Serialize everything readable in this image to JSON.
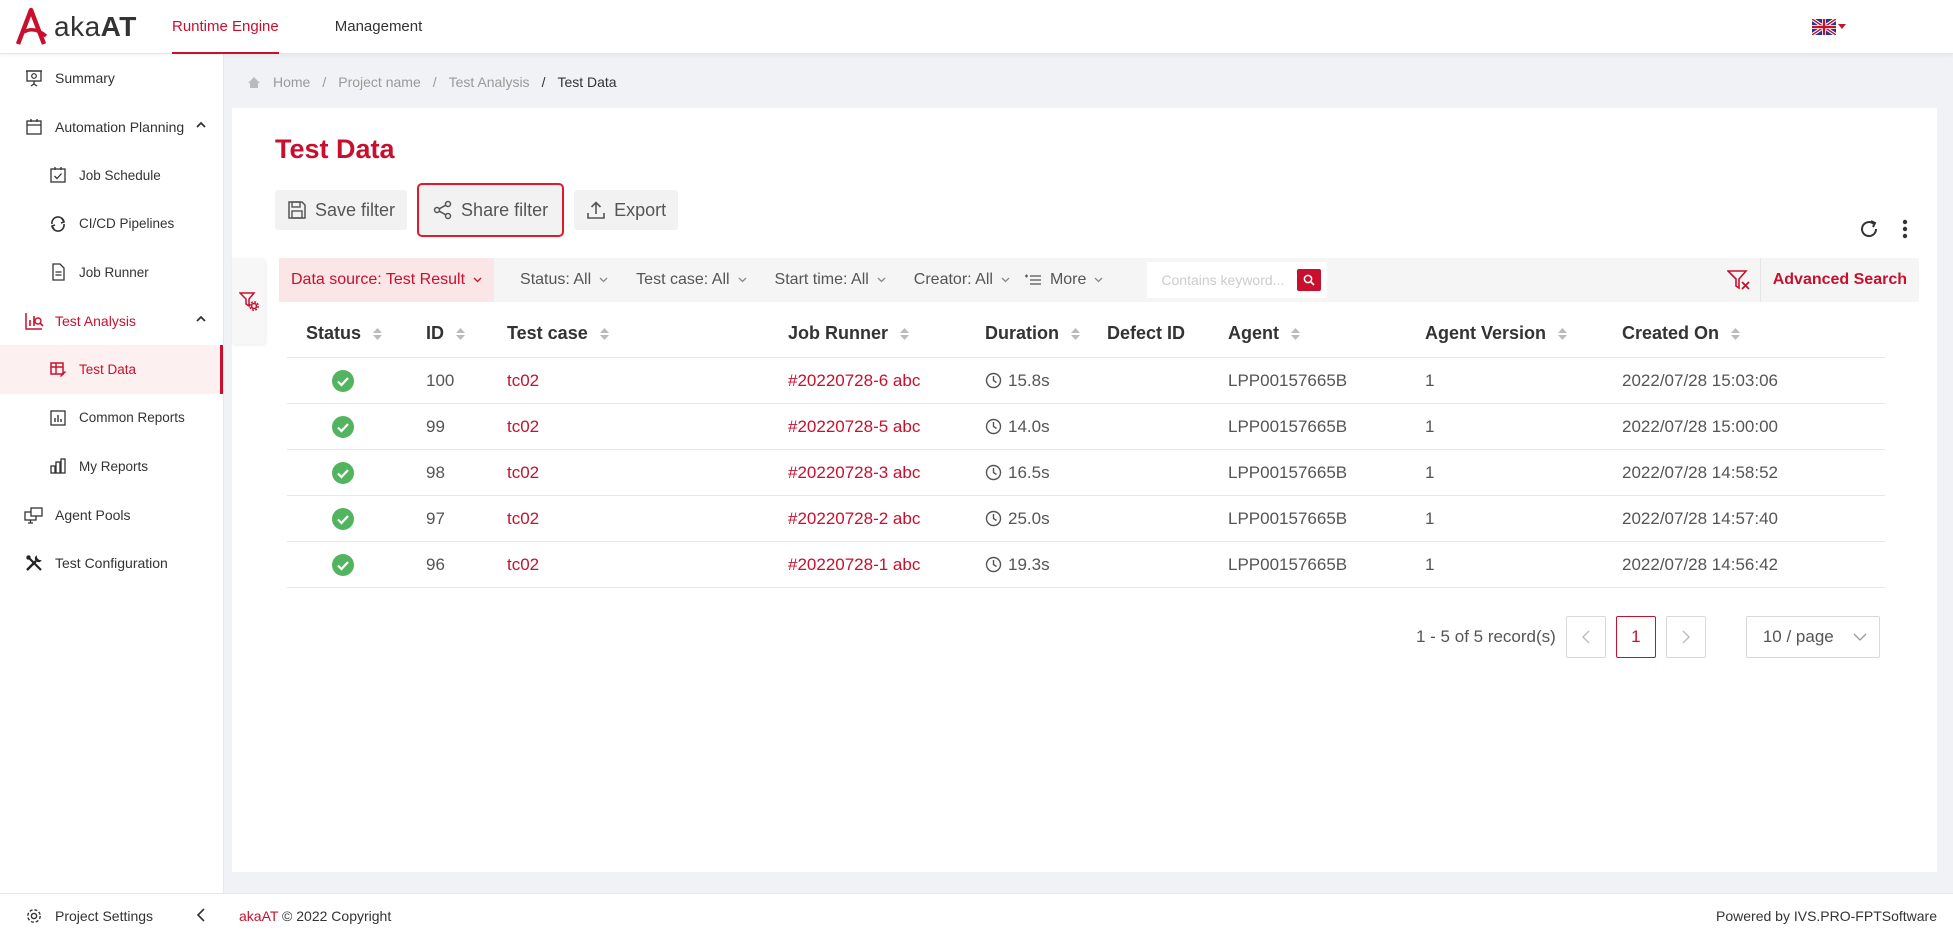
{
  "app": {
    "logo_prefix": "aka",
    "logo_suffix": "AT",
    "nav": [
      "Runtime Engine",
      "Management"
    ]
  },
  "sidebar": {
    "items": [
      {
        "label": "Summary"
      },
      {
        "label": "Automation Planning"
      },
      {
        "label": "Job Schedule"
      },
      {
        "label": "CI/CD Pipelines"
      },
      {
        "label": "Job Runner"
      },
      {
        "label": "Test Analysis"
      },
      {
        "label": "Test Data"
      },
      {
        "label": "Common Reports"
      },
      {
        "label": "My Reports"
      },
      {
        "label": "Agent Pools"
      },
      {
        "label": "Test Configuration"
      }
    ],
    "bottom_label": "Project Settings"
  },
  "breadcrumb": [
    "Home",
    "Project name",
    "Test Analysis",
    "Test Data"
  ],
  "page": {
    "title": "Test Data",
    "save_filter": "Save filter",
    "share_filter": "Share filter",
    "export": "Export"
  },
  "filters": {
    "data_source": "Data source: Test Result",
    "status": "Status: All",
    "test_case": "Test case: All",
    "start_time": "Start time: All",
    "creator": "Creator: All",
    "more": "More",
    "search_placeholder": "Contains keyword...",
    "advanced": "Advanced Search"
  },
  "table": {
    "headers": [
      "Status",
      "ID",
      "Test case",
      "Job Runner",
      "Duration",
      "Defect ID",
      "Agent",
      "Agent Version",
      "Created On"
    ],
    "rows": [
      {
        "id": "100",
        "test_case": "tc02",
        "job_runner": "#20220728-6 abc",
        "duration": "15.8s",
        "defect": "",
        "agent": "LPP00157665B",
        "version": "1",
        "created": "2022/07/28 15:03:06"
      },
      {
        "id": "99",
        "test_case": "tc02",
        "job_runner": "#20220728-5 abc",
        "duration": "14.0s",
        "defect": "",
        "agent": "LPP00157665B",
        "version": "1",
        "created": "2022/07/28 15:00:00"
      },
      {
        "id": "98",
        "test_case": "tc02",
        "job_runner": "#20220728-3 abc",
        "duration": "16.5s",
        "defect": "",
        "agent": "LPP00157665B",
        "version": "1",
        "created": "2022/07/28 14:58:52"
      },
      {
        "id": "97",
        "test_case": "tc02",
        "job_runner": "#20220728-2 abc",
        "duration": "25.0s",
        "defect": "",
        "agent": "LPP00157665B",
        "version": "1",
        "created": "2022/07/28 14:57:40"
      },
      {
        "id": "96",
        "test_case": "tc02",
        "job_runner": "#20220728-1 abc",
        "duration": "19.3s",
        "defect": "",
        "agent": "LPP00157665B",
        "version": "1",
        "created": "2022/07/28 14:56:42"
      }
    ]
  },
  "pagination": {
    "summary": "1 - 5 of 5 record(s)",
    "current": "1",
    "page_size": "10 / page"
  },
  "footer": {
    "brand": "akaAT",
    "copyright": " © 2022 Copyright",
    "powered_prefix": "Powered by ",
    "powered_name": "IVS.PRO-FPTSoftware"
  },
  "colors": {
    "accent": "#c8102e",
    "success": "#52b45f"
  }
}
